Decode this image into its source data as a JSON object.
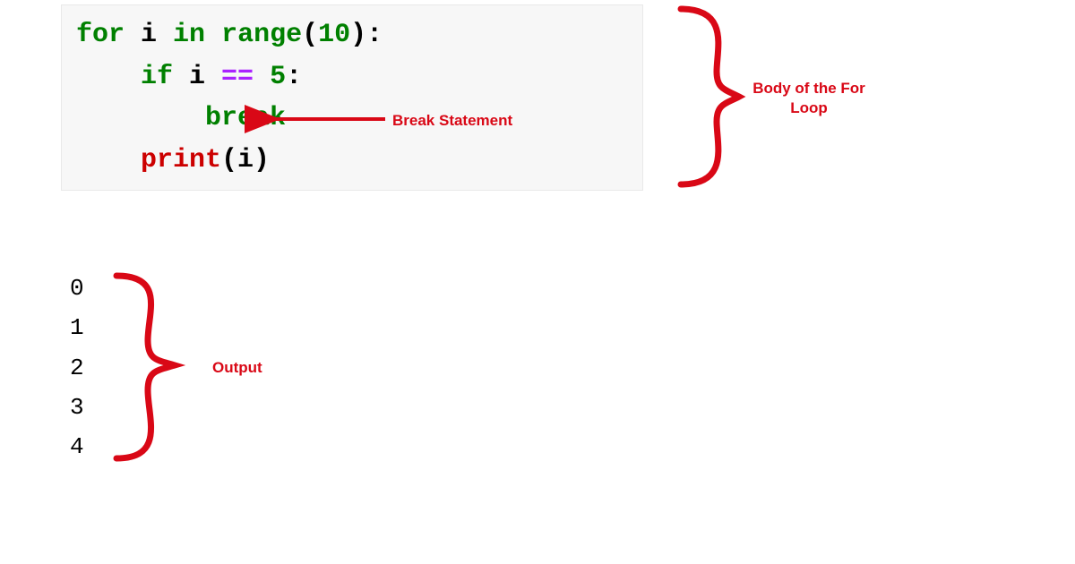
{
  "code": {
    "lines": [
      {
        "indent": "",
        "tokens": [
          {
            "cls": "kw-green",
            "text": "for"
          },
          {
            "cls": "plain",
            "text": " i "
          },
          {
            "cls": "kw-green",
            "text": "in"
          },
          {
            "cls": "plain",
            "text": " "
          },
          {
            "cls": "fn-builtin",
            "text": "range"
          },
          {
            "cls": "plain",
            "text": "("
          },
          {
            "cls": "num",
            "text": "10"
          },
          {
            "cls": "plain",
            "text": "):"
          }
        ]
      },
      {
        "indent": "    ",
        "tokens": [
          {
            "cls": "kw-green",
            "text": "if"
          },
          {
            "cls": "plain",
            "text": " i "
          },
          {
            "cls": "kw-purple",
            "text": "=="
          },
          {
            "cls": "plain",
            "text": " "
          },
          {
            "cls": "num",
            "text": "5"
          },
          {
            "cls": "plain",
            "text": ":"
          }
        ]
      },
      {
        "indent": "        ",
        "tokens": [
          {
            "cls": "kw-green",
            "text": "break"
          }
        ]
      },
      {
        "indent": "    ",
        "tokens": [
          {
            "cls": "print-red",
            "text": "print"
          },
          {
            "cls": "plain",
            "text": "(i)"
          }
        ]
      }
    ]
  },
  "output": {
    "values": [
      "0",
      "1",
      "2",
      "3",
      "4"
    ]
  },
  "annotations": {
    "break_label": "Break Statement",
    "body_label_line1": "Body of the For",
    "body_label_line2": "Loop",
    "output_label": "Output"
  }
}
